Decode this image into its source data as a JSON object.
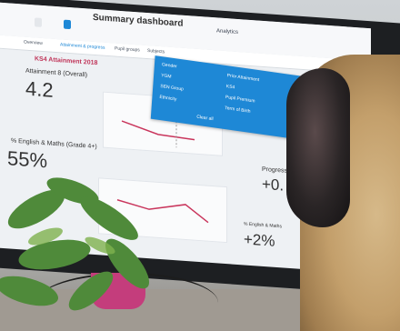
{
  "topbar": {
    "tab_primary": "Summary dashboard",
    "tab_secondary": "Analytics"
  },
  "tabs": [
    "Overview",
    "Attainment & progress",
    "Pupil groups",
    "Subjects"
  ],
  "section_title": "KS4 Attainment 2018",
  "metric1": {
    "label": "Attainment 8 (Overall)",
    "value": "4.2"
  },
  "metric2": {
    "label": "% English & Maths (Grade 4+)",
    "value": "55%"
  },
  "metric3": {
    "label": "Progress",
    "value": "+0."
  },
  "metric4": {
    "label": "% English & Maths",
    "value": "+2%"
  },
  "filter_panel": {
    "items": [
      "Gender",
      "Prior Attainment",
      "YGM",
      "KS4",
      "SEN Group",
      "Pupil Premium",
      "Ethnicity",
      "Term of Birth"
    ],
    "clear": "Clear all"
  },
  "chart_line_color": "#c9355c"
}
